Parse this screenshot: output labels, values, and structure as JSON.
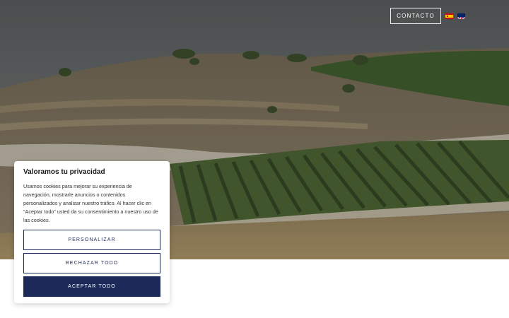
{
  "header": {
    "contact_label": "CONTACTO",
    "languages": [
      {
        "code": "es",
        "icon": "flag-spain-icon"
      },
      {
        "code": "en",
        "icon": "flag-uk-icon"
      }
    ]
  },
  "hero": {
    "image": "vineyard-hillside-photo"
  },
  "cookie_banner": {
    "title": "Valoramos tu privacidad",
    "text": "Usamos cookies para mejorar su experiencia de navegación, mostrarle anuncios o contenidos personalizados y analizar nuestro tráfico. Al hacer clic en \"Aceptar todo\" usted da su consentimiento a nuestro uso de las cookies.",
    "customize_label": "PERSONALIZAR",
    "reject_label": "RECHAZAR TODO",
    "accept_label": "ACEPTAR TODO",
    "accent_color": "#1c2a5a"
  }
}
